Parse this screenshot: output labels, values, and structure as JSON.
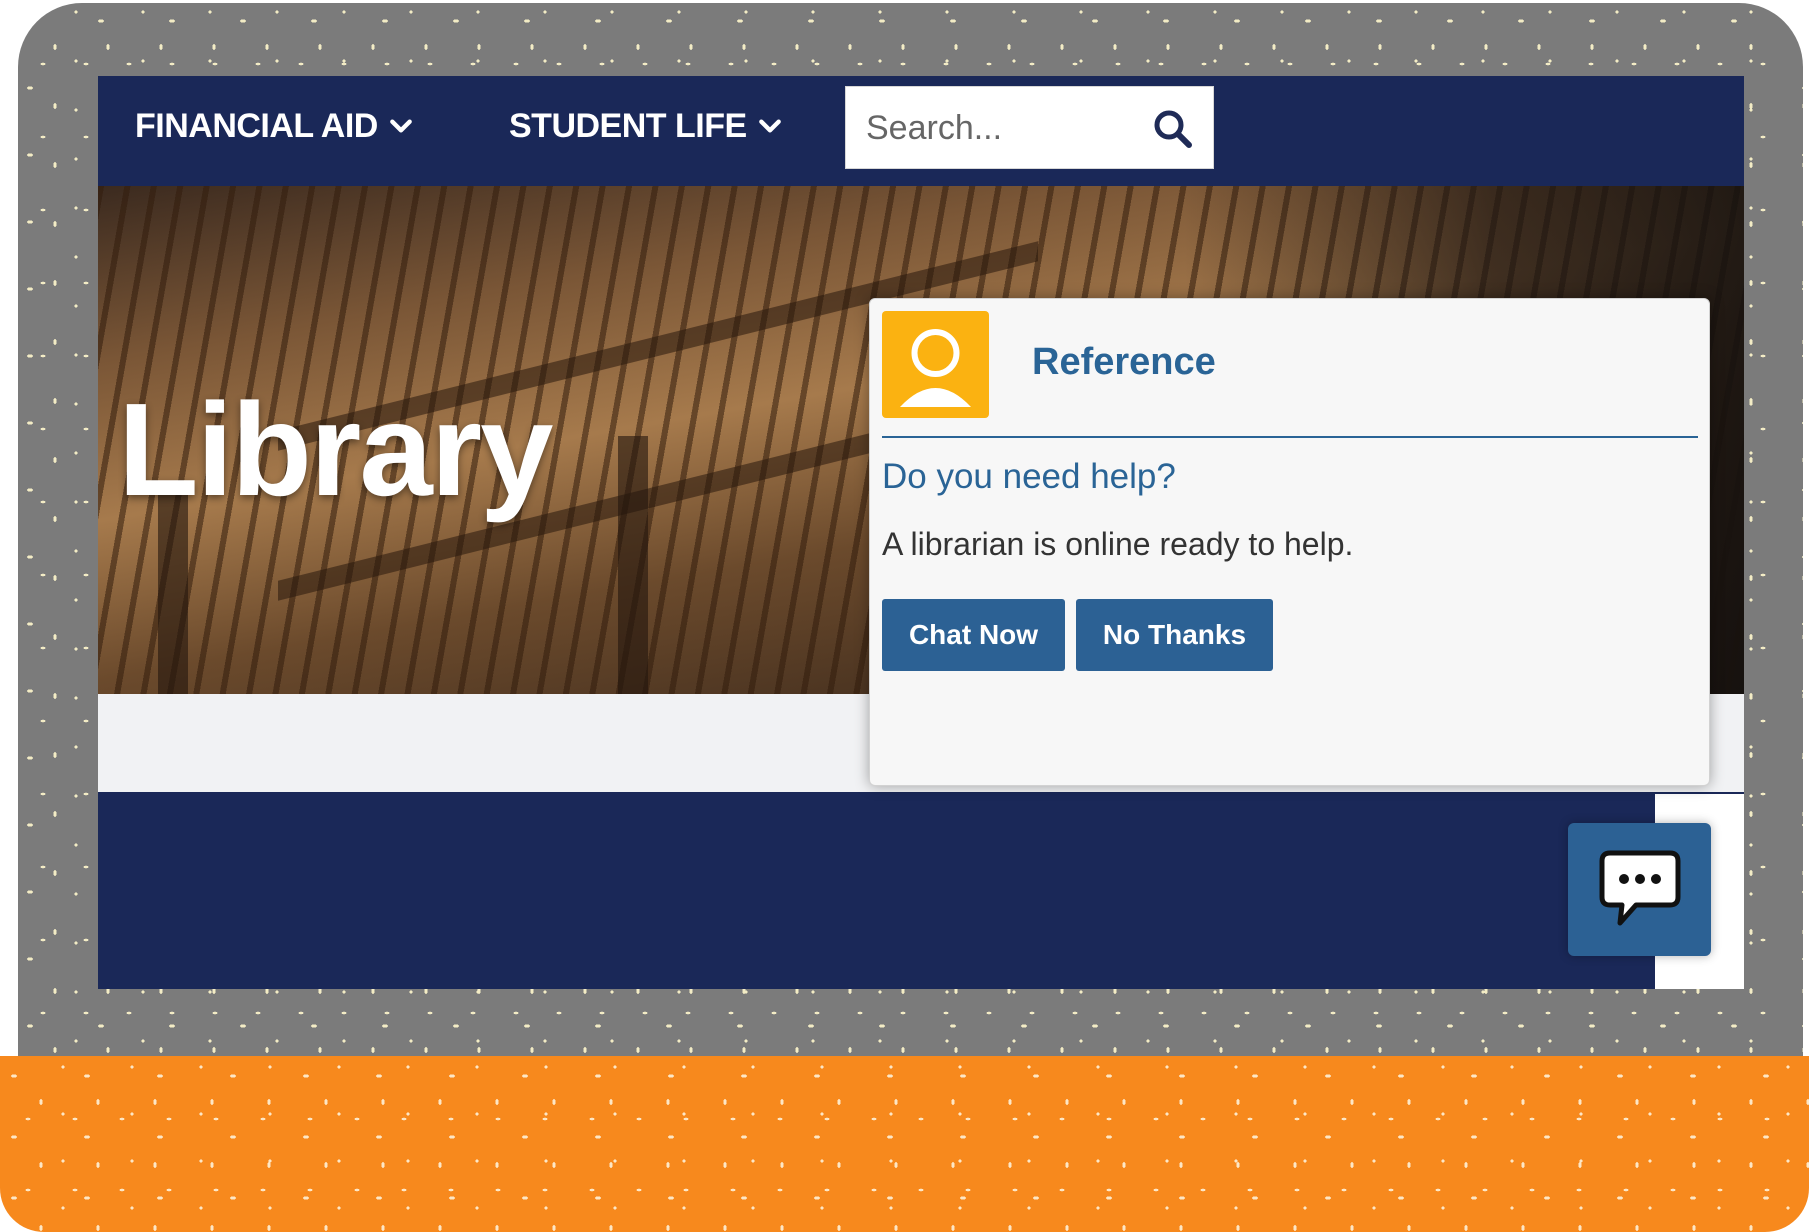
{
  "nav": {
    "financial_aid_label": "FINANCIAL AID",
    "student_life_label": "STUDENT LIFE"
  },
  "search": {
    "placeholder": "Search..."
  },
  "hero": {
    "title": "Library"
  },
  "chat_popup": {
    "title": "Reference",
    "question": "Do you need help?",
    "message": "A librarian is online ready to help.",
    "chat_now_label": "Chat Now",
    "no_thanks_label": "No Thanks"
  },
  "colors": {
    "navy": "#1a2858",
    "accent_blue": "#2c6194",
    "avatar_yellow": "#fbb211",
    "frame_orange": "#f7891d",
    "frame_gray": "#7b7b7b"
  },
  "icons": {
    "nav_chevron": "chevron-down-icon",
    "search": "search-icon",
    "avatar": "user-avatar-icon",
    "launcher": "chat-bubble-icon"
  }
}
